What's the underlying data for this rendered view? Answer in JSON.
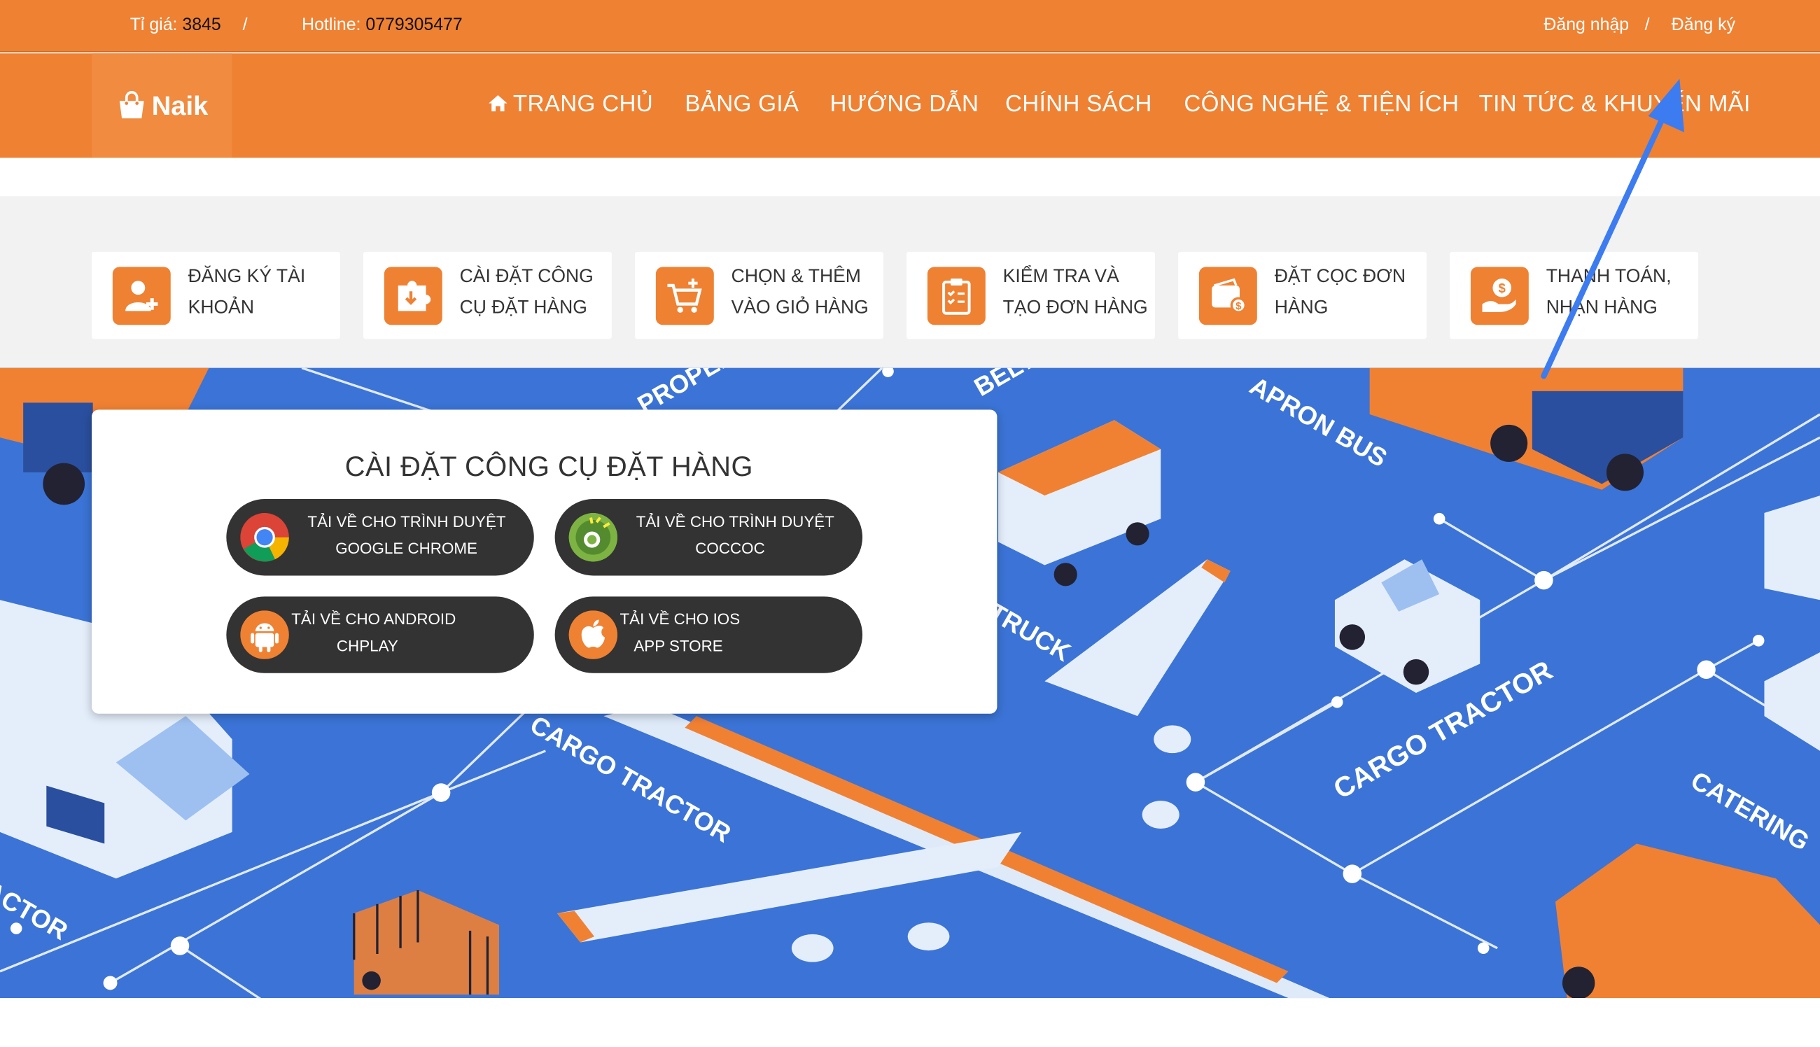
{
  "topbar": {
    "rate_label": "Tỉ giá:",
    "rate_value": "3845",
    "separator": "/",
    "hotline_label": "Hotline:",
    "hotline_value": "0779305477",
    "login": "Đăng nhập",
    "register": "Đăng ký"
  },
  "nav": {
    "logo_text": "Naik",
    "items": [
      {
        "label": "TRANG CHỦ",
        "icon": "home-icon"
      },
      {
        "label": "BẢNG GIÁ"
      },
      {
        "label": "HƯỚNG DẪN"
      },
      {
        "label": "CHÍNH SÁCH"
      },
      {
        "label": "CÔNG NGHỆ & TIỆN ÍCH"
      },
      {
        "label": "TIN TỨC & KHUYẾN MÃI"
      }
    ]
  },
  "steps": [
    {
      "line1": "ĐĂNG KÝ TÀI",
      "line2": "KHOẢN",
      "icon": "add-user-icon"
    },
    {
      "line1": "CÀI ĐẶT CÔNG",
      "line2": "CỤ ĐẶT HÀNG",
      "icon": "install-puzzle-icon"
    },
    {
      "line1": "CHỌN & THÊM",
      "line2": "VÀO GIỎ HÀNG",
      "icon": "cart-add-icon"
    },
    {
      "line1": "KIỂM TRA VÀ",
      "line2": "TẠO ĐƠN HÀNG",
      "icon": "checklist-icon"
    },
    {
      "line1": "ĐẶT CỌC ĐƠN",
      "line2": "HÀNG",
      "icon": "wallet-icon"
    },
    {
      "line1": "THANH TOÁN,",
      "line2": "NHẬN HÀNG",
      "icon": "hand-money-icon"
    }
  ],
  "hero": {
    "labels": [
      "PROPELLER LOADER",
      "BELT LOADER",
      "APRON BUS",
      "CARGO TRACTOR",
      "CARGO TRACTOR",
      "CATERING",
      "TRUCK",
      "TRACTOR"
    ]
  },
  "install_card": {
    "title": "CÀI ĐẶT CÔNG CỤ ĐẶT HÀNG",
    "buttons": [
      {
        "line1": "TẢI VỀ CHO TRÌNH DUYỆT",
        "line2": "GOOGLE CHROME",
        "icon": "chrome-icon"
      },
      {
        "line1": "TẢI VỀ CHO TRÌNH DUYỆT",
        "line2": "COCCOC",
        "icon": "coccoc-icon"
      },
      {
        "line1": "TẢI VỀ CHO ANDROID",
        "line2": "CHPLAY",
        "icon": "android-icon"
      },
      {
        "line1": "TẢI VỀ CHO IOS",
        "line2": "APP STORE",
        "icon": "apple-icon"
      }
    ]
  },
  "colors": {
    "brand_orange": "#ef8133",
    "hero_blue": "#3b74d6",
    "button_dark": "#333333",
    "annotation_arrow": "#3c7cf0"
  }
}
